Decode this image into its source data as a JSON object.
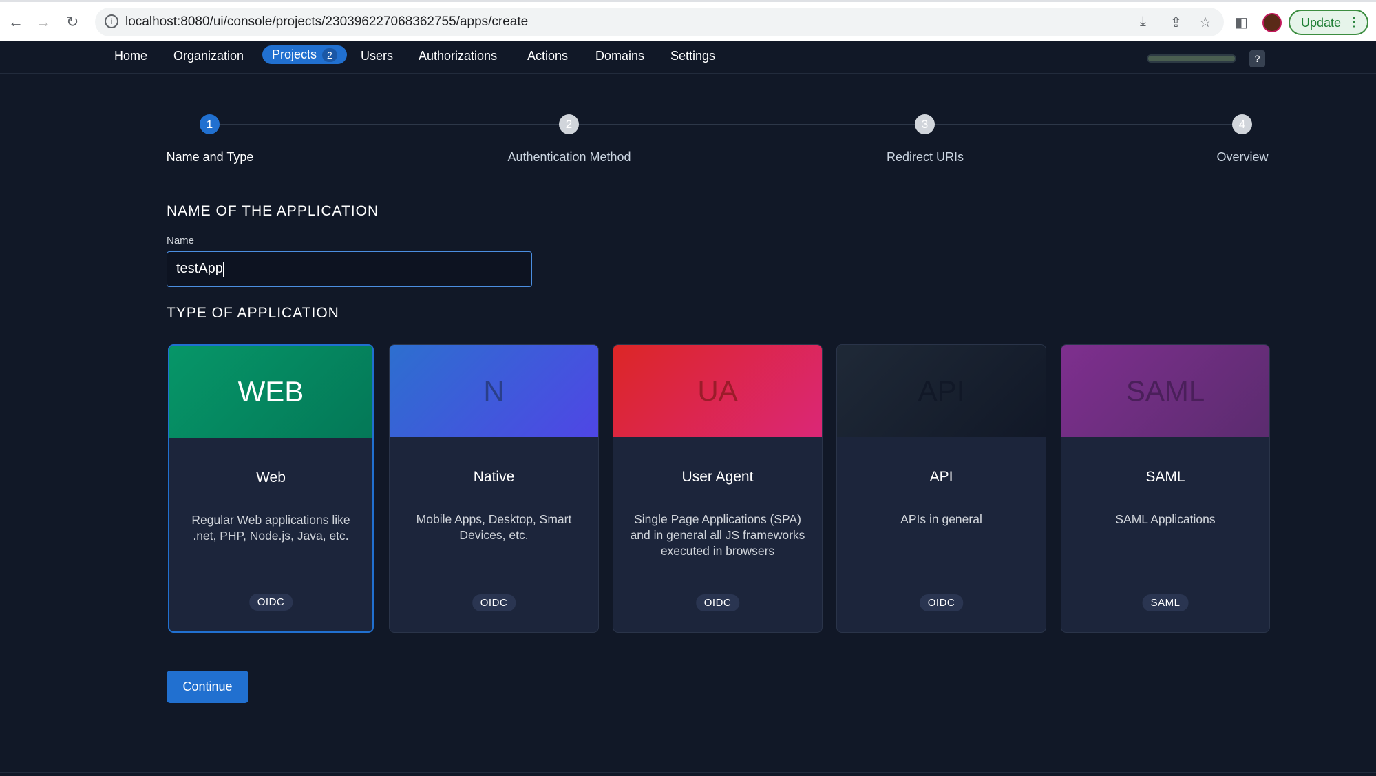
{
  "browser": {
    "url": "localhost:8080/ui/console/projects/230396227068362755/apps/create",
    "update_label": "Update"
  },
  "nav": {
    "items": [
      {
        "label": "Home"
      },
      {
        "label": "Organization"
      },
      {
        "label": "Projects",
        "badge": "2"
      },
      {
        "label": "Users"
      },
      {
        "label": "Authorizations"
      },
      {
        "label": "Actions"
      },
      {
        "label": "Domains"
      },
      {
        "label": "Settings"
      }
    ],
    "help": "?"
  },
  "stepper": {
    "steps": [
      {
        "num": "1",
        "label": "Name and Type"
      },
      {
        "num": "2",
        "label": "Authentication Method"
      },
      {
        "num": "3",
        "label": "Redirect URIs"
      },
      {
        "num": "4",
        "label": "Overview"
      }
    ],
    "active": 1
  },
  "form": {
    "name_heading": "NAME OF THE APPLICATION",
    "name_label": "Name",
    "name_value": "testApp",
    "type_heading": "TYPE OF APPLICATION"
  },
  "cards": [
    {
      "abbr": "WEB",
      "title": "Web",
      "desc": "Regular Web applications like .net, PHP, Node.js, Java, etc.",
      "tag": "OIDC",
      "colors": [
        "#069668",
        "#047857"
      ],
      "selected": true
    },
    {
      "abbr": "N",
      "title": "Native",
      "desc": "Mobile Apps, Desktop, Smart Devices, etc.",
      "tag": "OIDC",
      "colors": [
        "#2d6fcf",
        "#4f46e5"
      ]
    },
    {
      "abbr": "UA",
      "title": "User Agent",
      "desc": "Single Page Applications (SPA) and in general all JS frameworks executed in browsers",
      "tag": "OIDC",
      "colors": [
        "#dc2626",
        "#db2777"
      ]
    },
    {
      "abbr": "API",
      "title": "API",
      "desc": "APIs in general",
      "tag": "OIDC",
      "colors": [
        "#1f2937",
        "#111827"
      ]
    },
    {
      "abbr": "SAML",
      "title": "SAML",
      "desc": "SAML Applications",
      "tag": "SAML",
      "colors": [
        "#7e2f8e",
        "#5b2c6f"
      ]
    }
  ],
  "continue_label": "Continue"
}
